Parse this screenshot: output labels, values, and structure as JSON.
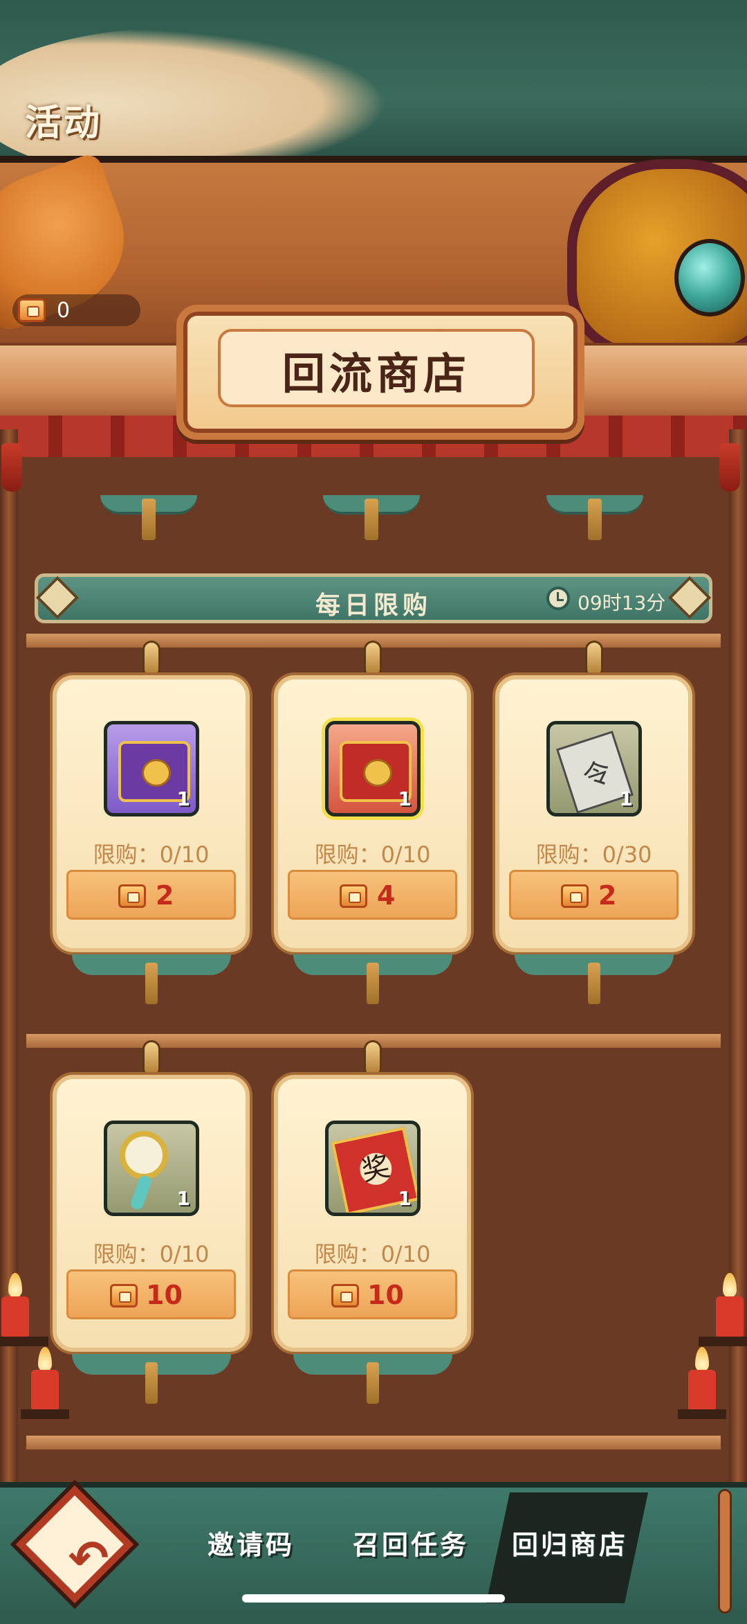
{
  "header": {
    "title": "活动"
  },
  "currency": {
    "icon": "treasure-chest-icon",
    "value": "0"
  },
  "shop": {
    "title": "回流商店",
    "section": {
      "title": "每日限购",
      "timer_icon": "clock-icon",
      "timer": "09时13分"
    },
    "items": [
      {
        "icon": "purple-chest-icon",
        "qty": "1",
        "limit": "限购：0/10",
        "price_icon": "treasure-chest-icon",
        "price": "2"
      },
      {
        "icon": "red-chest-icon",
        "qty": "1",
        "limit": "限购：0/10",
        "price_icon": "treasure-chest-icon",
        "price": "4"
      },
      {
        "icon": "token-ticket-icon",
        "qty": "1",
        "limit": "限购：0/30",
        "price_icon": "treasure-chest-icon",
        "price": "2"
      },
      {
        "icon": "magnifier-icon",
        "qty": "1",
        "limit": "限购：0/10",
        "price_icon": "treasure-chest-icon",
        "price": "10"
      },
      {
        "icon": "reward-scroll-icon",
        "qty": "1",
        "limit": "限购：0/10",
        "price_icon": "treasure-chest-icon",
        "price": "10"
      }
    ]
  },
  "bottom_nav": {
    "back_icon": "back-arrow-icon",
    "tabs": [
      {
        "label": "邀请码",
        "active": false
      },
      {
        "label": "召回任务",
        "active": false
      },
      {
        "label": "回归商店",
        "active": true
      }
    ]
  },
  "colors": {
    "price_red": "#c62a1b",
    "limit_text": "#c2884a",
    "teal_bar": "#4d8c78"
  }
}
